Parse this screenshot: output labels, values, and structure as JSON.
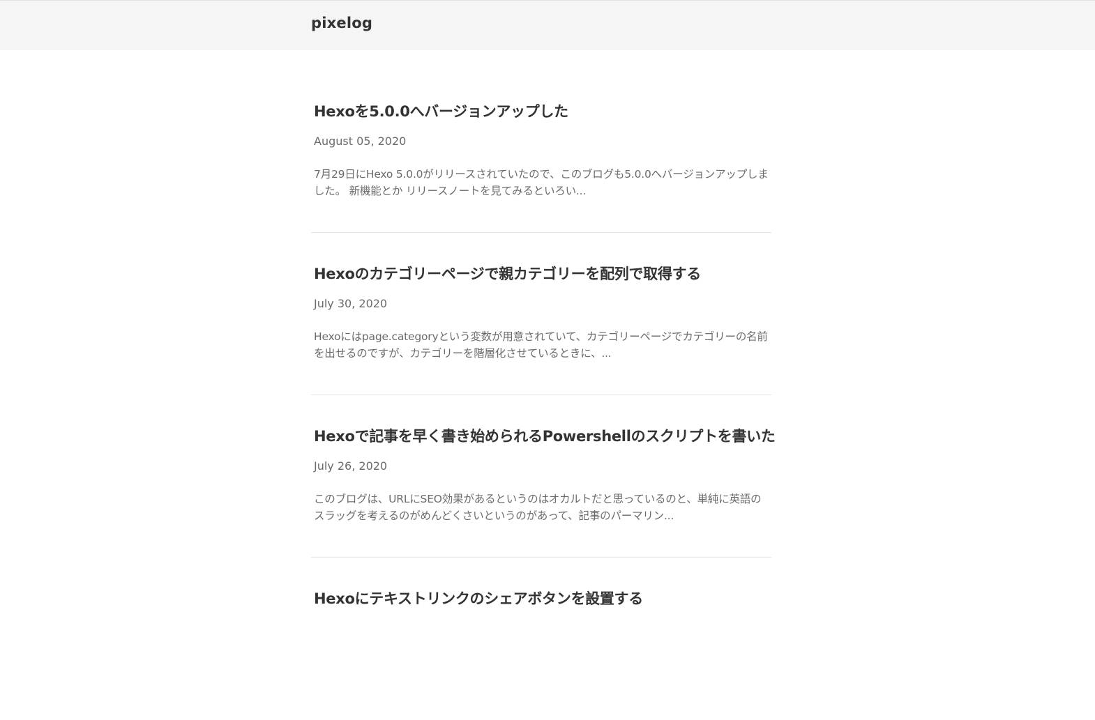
{
  "site": {
    "title": "pixelog"
  },
  "posts": [
    {
      "title": "Hexoを5.0.0へバージョンアップした",
      "date": "August 05, 2020",
      "excerpt": "7月29日にHexo 5.0.0がリリースされていたので、このブログも5.0.0へバージョンアップしました。 新機能とか リリースノートを見てみるといろい..."
    },
    {
      "title": "Hexoのカテゴリーページで親カテゴリーを配列で取得する",
      "date": "July 30, 2020",
      "excerpt": "Hexoにはpage.categoryという変数が用意されていて、カテゴリーページでカテゴリーの名前を出せるのですが、カテゴリーを階層化させているときに、..."
    },
    {
      "title": "Hexoで記事を早く書き始められるPowershellのスクリプトを書いた",
      "date": "July 26, 2020",
      "excerpt": "このブログは、URLにSEO効果があるというのはオカルトだと思っているのと、単純に英語のスラッグを考えるのがめんどくさいというのがあって、記事のパーマリン..."
    },
    {
      "title": "Hexoにテキストリンクのシェアボタンを設置する"
    }
  ]
}
